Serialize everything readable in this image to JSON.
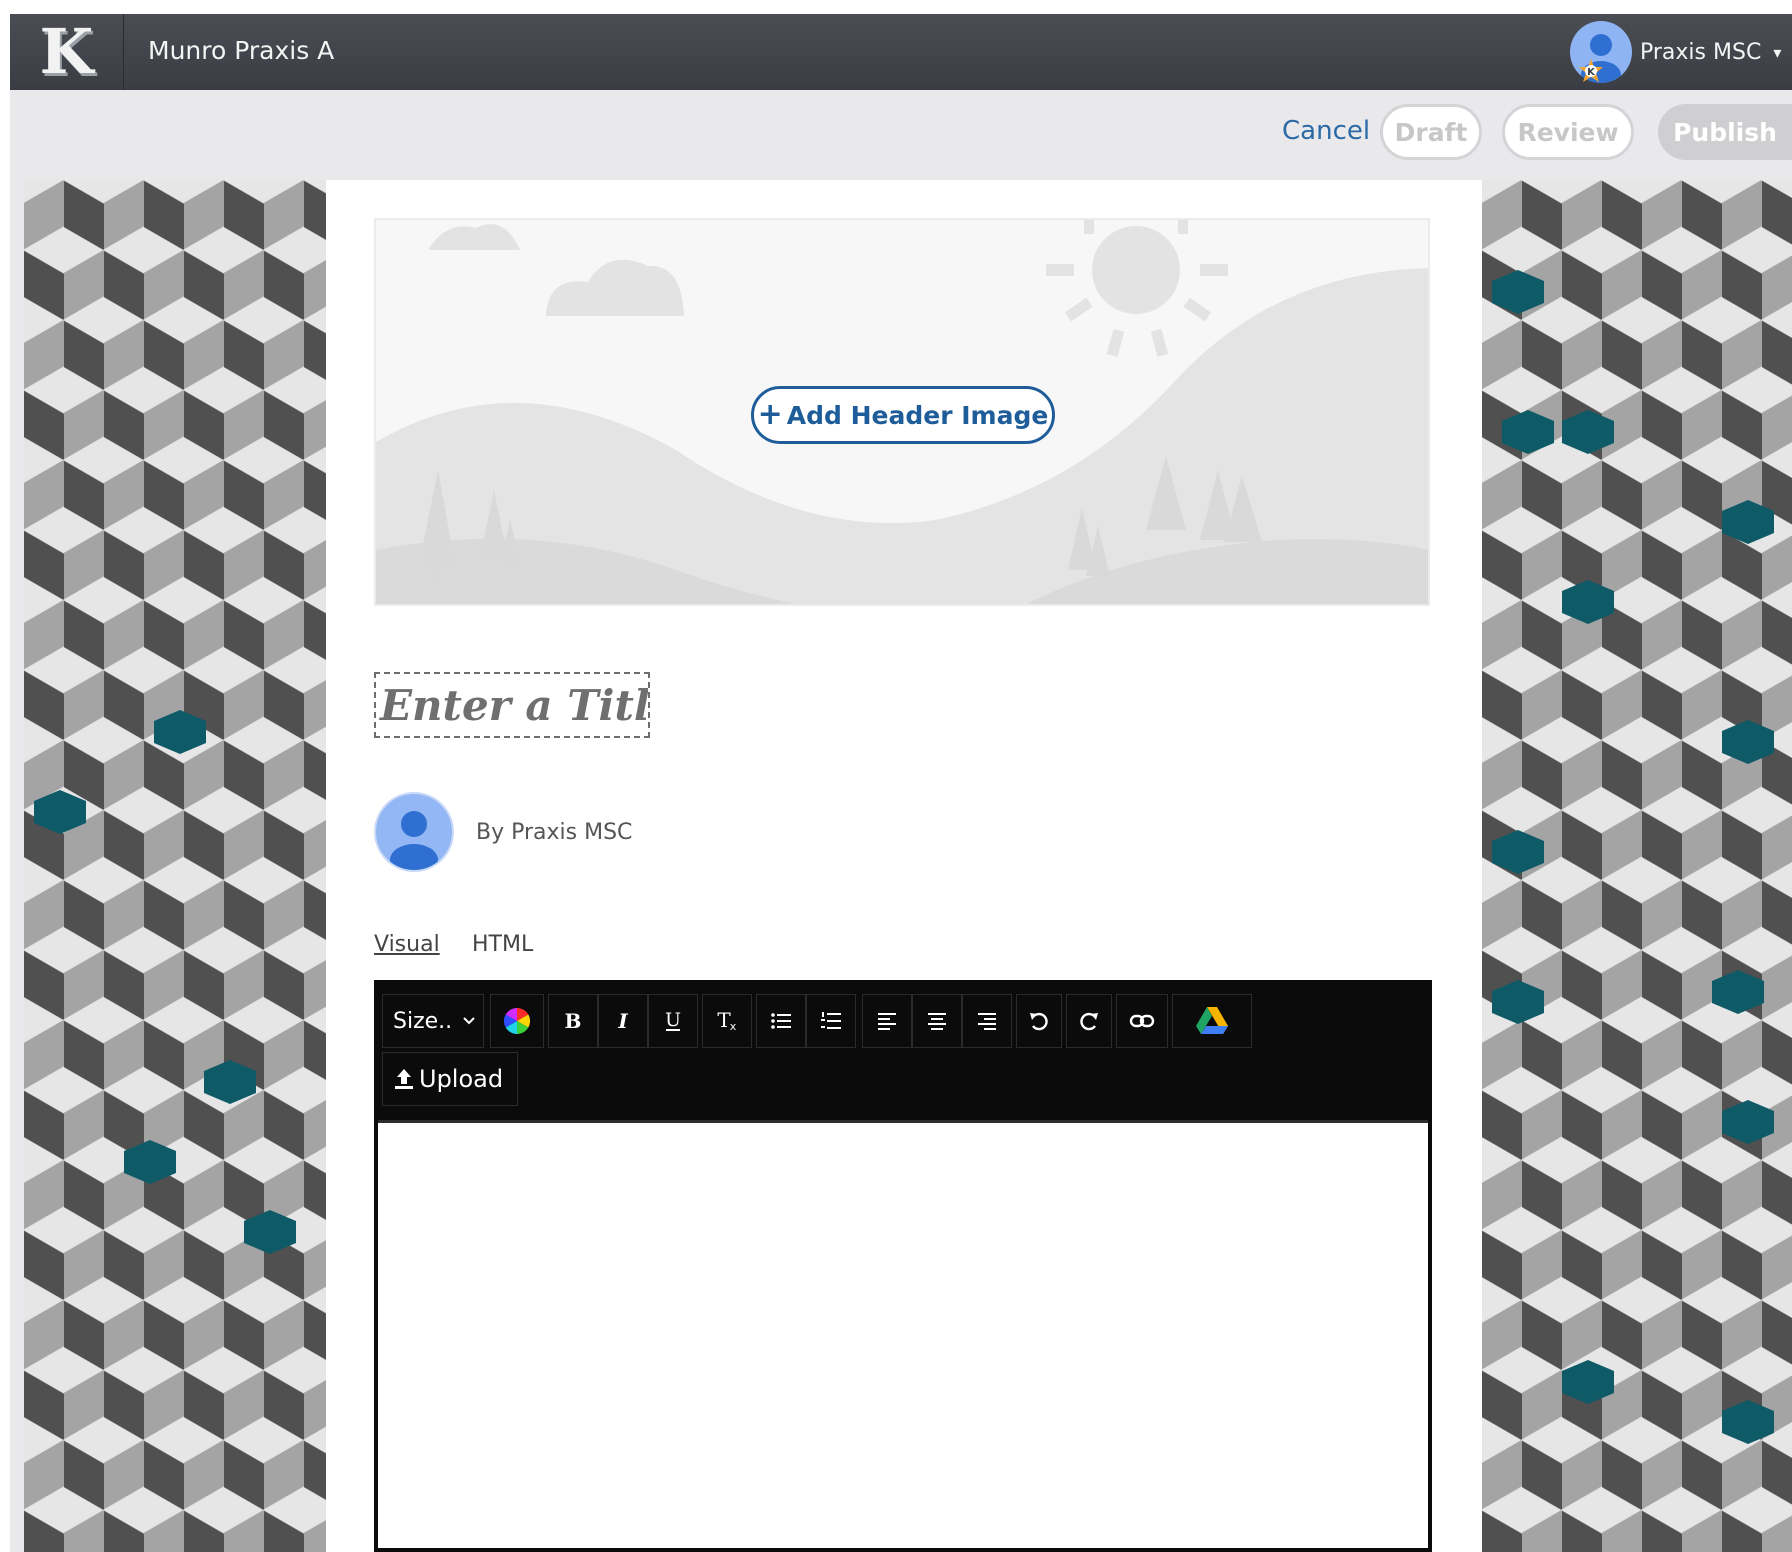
{
  "app": {
    "site_name": "Munro Praxis A",
    "logo_letter": "K"
  },
  "user": {
    "name": "Praxis MSC",
    "caret": "▾"
  },
  "actions": {
    "cancel": "Cancel",
    "draft": "Draft",
    "review": "Review",
    "publish": "Publish"
  },
  "header_image": {
    "button_label": "Add Header Image",
    "plus": "+"
  },
  "post": {
    "title_placeholder": "Enter a Title...",
    "byline": "By Praxis MSC"
  },
  "editor": {
    "tabs": [
      "Visual",
      "HTML"
    ],
    "size_label": "Size..",
    "upload_label": "Upload"
  },
  "colors": {
    "topbar": "#3f4248",
    "accent": "#1e5d9a",
    "teal": "#0e5a66"
  }
}
